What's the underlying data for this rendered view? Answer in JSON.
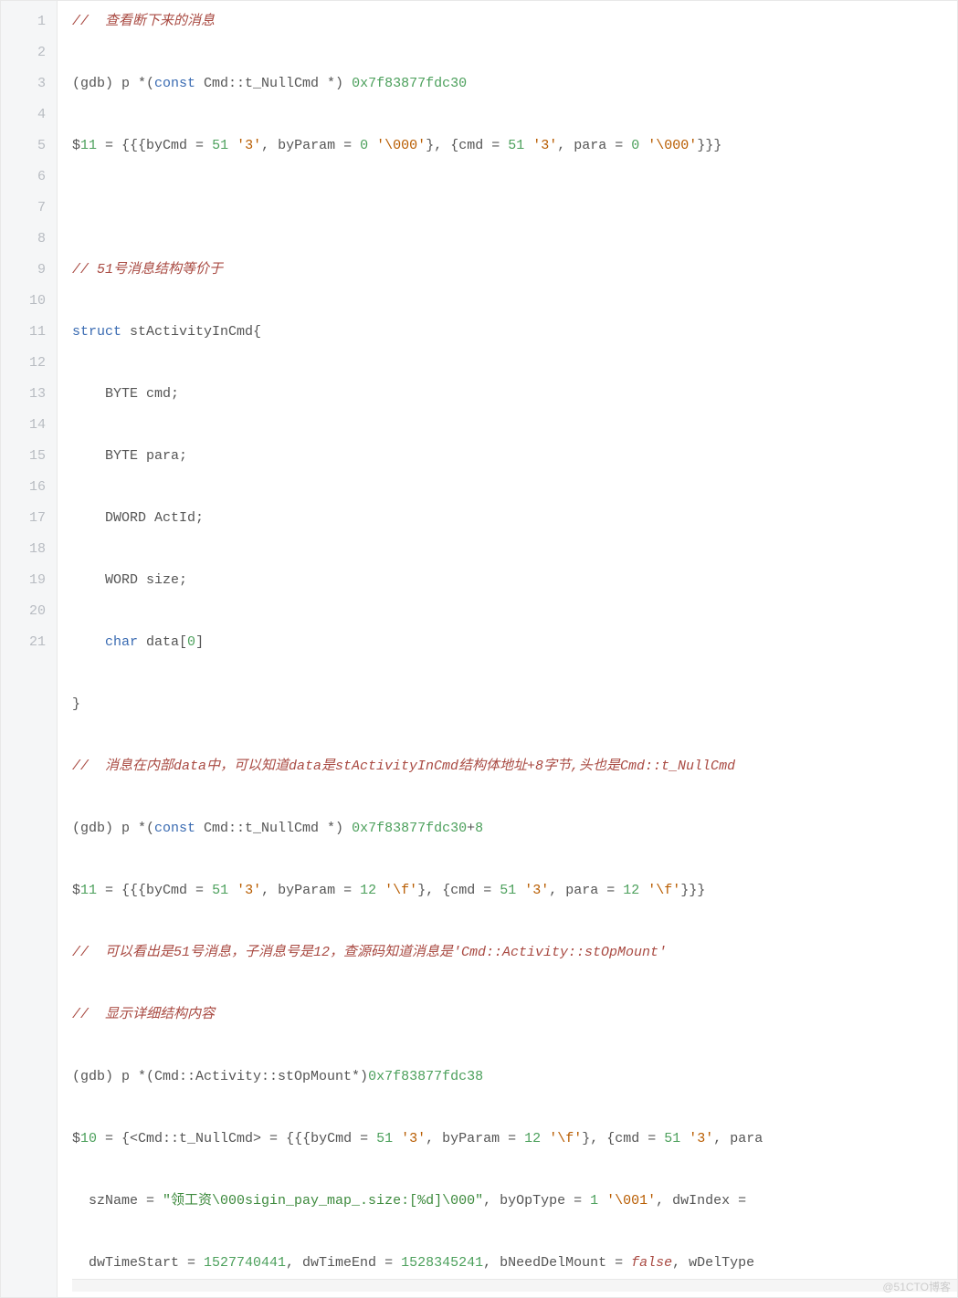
{
  "watermark": "@51CTO博客",
  "gutter": [
    "1",
    "2",
    "3",
    "4",
    "5",
    "6",
    "7",
    "8",
    "9",
    "10",
    "11",
    "12",
    "13",
    "14",
    "15",
    "16",
    "17",
    "18",
    "19",
    "20",
    "21"
  ],
  "lines": {
    "l1_comment": "//  查看断下来的消息",
    "l2_prefix": "(gdb) p *(",
    "l2_const": "const",
    "l2_type": " Cmd::t_NullCmd *) ",
    "l2_addr": "0x7f83877fdc30",
    "l3_a": "$",
    "l3_n1": "11",
    "l3_b": " = {{{byCmd = ",
    "l3_n2": "51",
    "l3_c": " ",
    "l3_s1": "'3'",
    "l3_d": ", byParam = ",
    "l3_n3": "0",
    "l3_e": " ",
    "l3_s2": "'\\000'",
    "l3_f": "}, {cmd = ",
    "l3_n4": "51",
    "l3_g": " ",
    "l3_s3": "'3'",
    "l3_h": ", para = ",
    "l3_n5": "0",
    "l3_i": " ",
    "l3_s4": "'\\000'",
    "l3_j": "}}}",
    "l5_comment": "// 51号消息结构等价于",
    "l6_kw": "struct",
    "l6_name": " stActivityInCmd{",
    "l7": "    BYTE cmd;",
    "l8": "    BYTE para;",
    "l9": "    DWORD ActId;",
    "l10": "    WORD size;",
    "l11_a": "    ",
    "l11_kw": "char",
    "l11_b": " data[",
    "l11_n": "0",
    "l11_c": "]",
    "l12": "}",
    "l13_comment": "//  消息在内部data中，可以知道data是stActivityInCmd结构体地址+8字节,头也是Cmd::t_NullCmd",
    "l14_prefix": "(gdb) p *(",
    "l14_const": "const",
    "l14_type": " Cmd::t_NullCmd *) ",
    "l14_addr": "0x7f83877fdc30",
    "l14_plus": "+",
    "l14_n": "8",
    "l15_a": "$",
    "l15_n1": "11",
    "l15_b": " = {{{byCmd = ",
    "l15_n2": "51",
    "l15_c": " ",
    "l15_s1": "'3'",
    "l15_d": ", byParam = ",
    "l15_n3": "12",
    "l15_e": " ",
    "l15_s2": "'\\f'",
    "l15_f": "}, {cmd = ",
    "l15_n4": "51",
    "l15_g": " ",
    "l15_s3": "'3'",
    "l15_h": ", para = ",
    "l15_n5": "12",
    "l15_i": " ",
    "l15_s4": "'\\f'",
    "l15_j": "}}}",
    "l16_comment": "//  可以看出是51号消息，子消息号是12，查源码知道消息是'Cmd::Activity::stOpMount'",
    "l17_comment": "//  显示详细结构内容",
    "l18_prefix": "(gdb) p *(Cmd::Activity::stOpMount*)",
    "l18_addr": "0x7f83877fdc38",
    "l19_a": "$",
    "l19_n1": "10",
    "l19_b": " = {<Cmd::t_NullCmd> = {{{byCmd = ",
    "l19_n2": "51",
    "l19_c": " ",
    "l19_s1": "'3'",
    "l19_d": ", byParam = ",
    "l19_n3": "12",
    "l19_e": " ",
    "l19_s2": "'\\f'",
    "l19_f": "}, {cmd = ",
    "l19_n4": "51",
    "l19_g": " ",
    "l19_s3": "'3'",
    "l19_h": ", para",
    "l20_a": "  szName = ",
    "l20_str": "\"领工资\\000sigin_pay_map_.size:[%d]\\000\"",
    "l20_b": ", byOpType = ",
    "l20_n1": "1",
    "l20_c": " ",
    "l20_s1": "'\\001'",
    "l20_d": ", dwIndex = ",
    "l21_a": "  dwTimeStart = ",
    "l21_n1": "1527740441",
    "l21_b": ", dwTimeEnd = ",
    "l21_n2": "1528345241",
    "l21_c": ", bNeedDelMount = ",
    "l21_bool": "false",
    "l21_d": ", wDelType"
  }
}
